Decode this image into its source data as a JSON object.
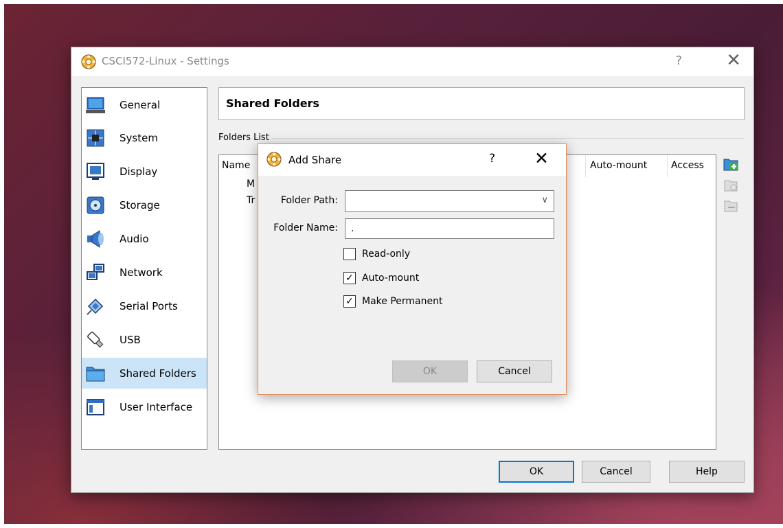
{
  "window": {
    "title": "CSCI572-Linux - Settings",
    "help_glyph": "?",
    "close_glyph": "✕"
  },
  "sidebar": {
    "items": [
      {
        "label": "General",
        "icon": "general-icon",
        "selected": false
      },
      {
        "label": "System",
        "icon": "system-icon",
        "selected": false
      },
      {
        "label": "Display",
        "icon": "display-icon",
        "selected": false
      },
      {
        "label": "Storage",
        "icon": "storage-icon",
        "selected": false
      },
      {
        "label": "Audio",
        "icon": "audio-icon",
        "selected": false
      },
      {
        "label": "Network",
        "icon": "network-icon",
        "selected": false
      },
      {
        "label": "Serial Ports",
        "icon": "serial-ports-icon",
        "selected": false
      },
      {
        "label": "USB",
        "icon": "usb-icon",
        "selected": false
      },
      {
        "label": "Shared Folders",
        "icon": "shared-folders-icon",
        "selected": true
      },
      {
        "label": "User Interface",
        "icon": "user-interface-icon",
        "selected": false
      }
    ]
  },
  "page": {
    "title": "Shared Folders",
    "group_label": "Folders List",
    "columns": {
      "name": "Name",
      "automount": "Auto-mount",
      "access": "Access"
    },
    "rows": [
      "M",
      "Tr"
    ]
  },
  "footer": {
    "ok": "OK",
    "cancel": "Cancel",
    "help": "Help"
  },
  "dialog": {
    "title": "Add Share",
    "help_glyph": "?",
    "close_glyph": "✕",
    "folder_path_label": "Folder Path:",
    "folder_path_value": "",
    "folder_name_label": "Folder Name:",
    "folder_name_value": ".",
    "readonly_label": "Read-only",
    "readonly_checked": false,
    "automount_label": "Auto-mount",
    "automount_checked": true,
    "permanent_label": "Make Permanent",
    "permanent_checked": true,
    "ok": "OK",
    "cancel": "Cancel"
  },
  "colors": {
    "selection": "#cce4f7",
    "dialog_border": "#e58a5c",
    "default_button_border": "#0078d7"
  }
}
